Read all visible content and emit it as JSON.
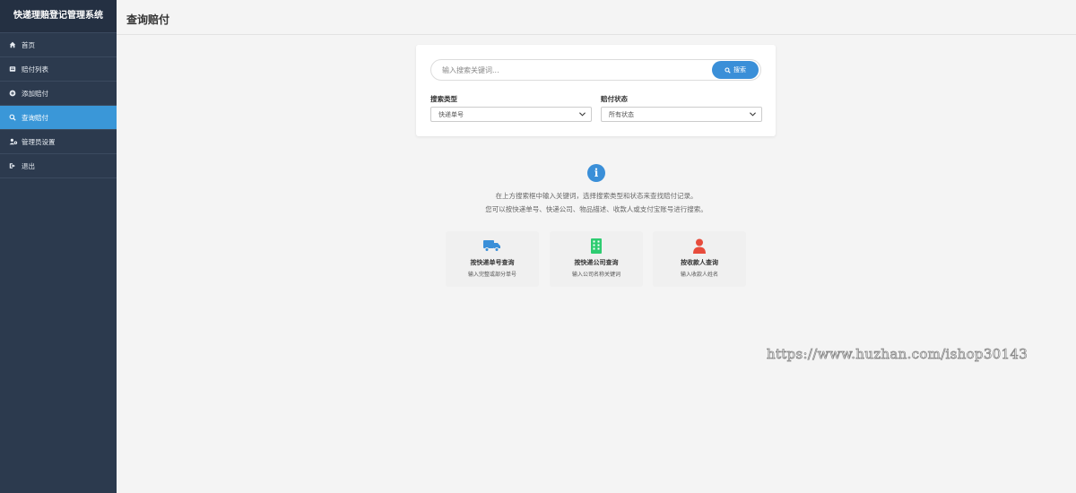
{
  "app": {
    "title": "快递理赔登记管理系统"
  },
  "sidebar": {
    "items": [
      {
        "label": "首页",
        "icon": "home-icon",
        "active": false
      },
      {
        "label": "赔付列表",
        "icon": "list-icon",
        "active": false
      },
      {
        "label": "添加赔付",
        "icon": "plus-circle-icon",
        "active": false
      },
      {
        "label": "查询赔付",
        "icon": "search-icon",
        "active": true
      },
      {
        "label": "管理员设置",
        "icon": "users-cog-icon",
        "active": false
      },
      {
        "label": "退出",
        "icon": "logout-icon",
        "active": false
      }
    ]
  },
  "page": {
    "title": "查询赔付"
  },
  "search": {
    "placeholder": "输入搜索关键词...",
    "button_label": "搜索",
    "type_label": "搜索类型",
    "type_value": "快递单号",
    "status_label": "赔付状态",
    "status_value": "所有状态"
  },
  "hint": {
    "line1": "在上方搜索框中输入关键词，选择搜索类型和状态来查找赔付记录。",
    "line2": "您可以按快递单号、快递公司、物品描述、收款人或支付宝账号进行搜索。"
  },
  "features": [
    {
      "title": "按快递单号查询",
      "desc": "输入完整或部分单号",
      "icon": "truck-icon",
      "color": "#3a8fd8"
    },
    {
      "title": "按快递公司查询",
      "desc": "输入公司名称关键词",
      "icon": "building-icon",
      "color": "#2ecc71"
    },
    {
      "title": "按收款人查询",
      "desc": "输入收款人姓名",
      "icon": "user-icon",
      "color": "#e74c3c"
    }
  ],
  "colors": {
    "sidebar": "#2c3a4e",
    "accent": "#3a8fd8",
    "background": "#f4f4f4"
  },
  "watermark": "https://www.huzhan.com/ishop30143"
}
